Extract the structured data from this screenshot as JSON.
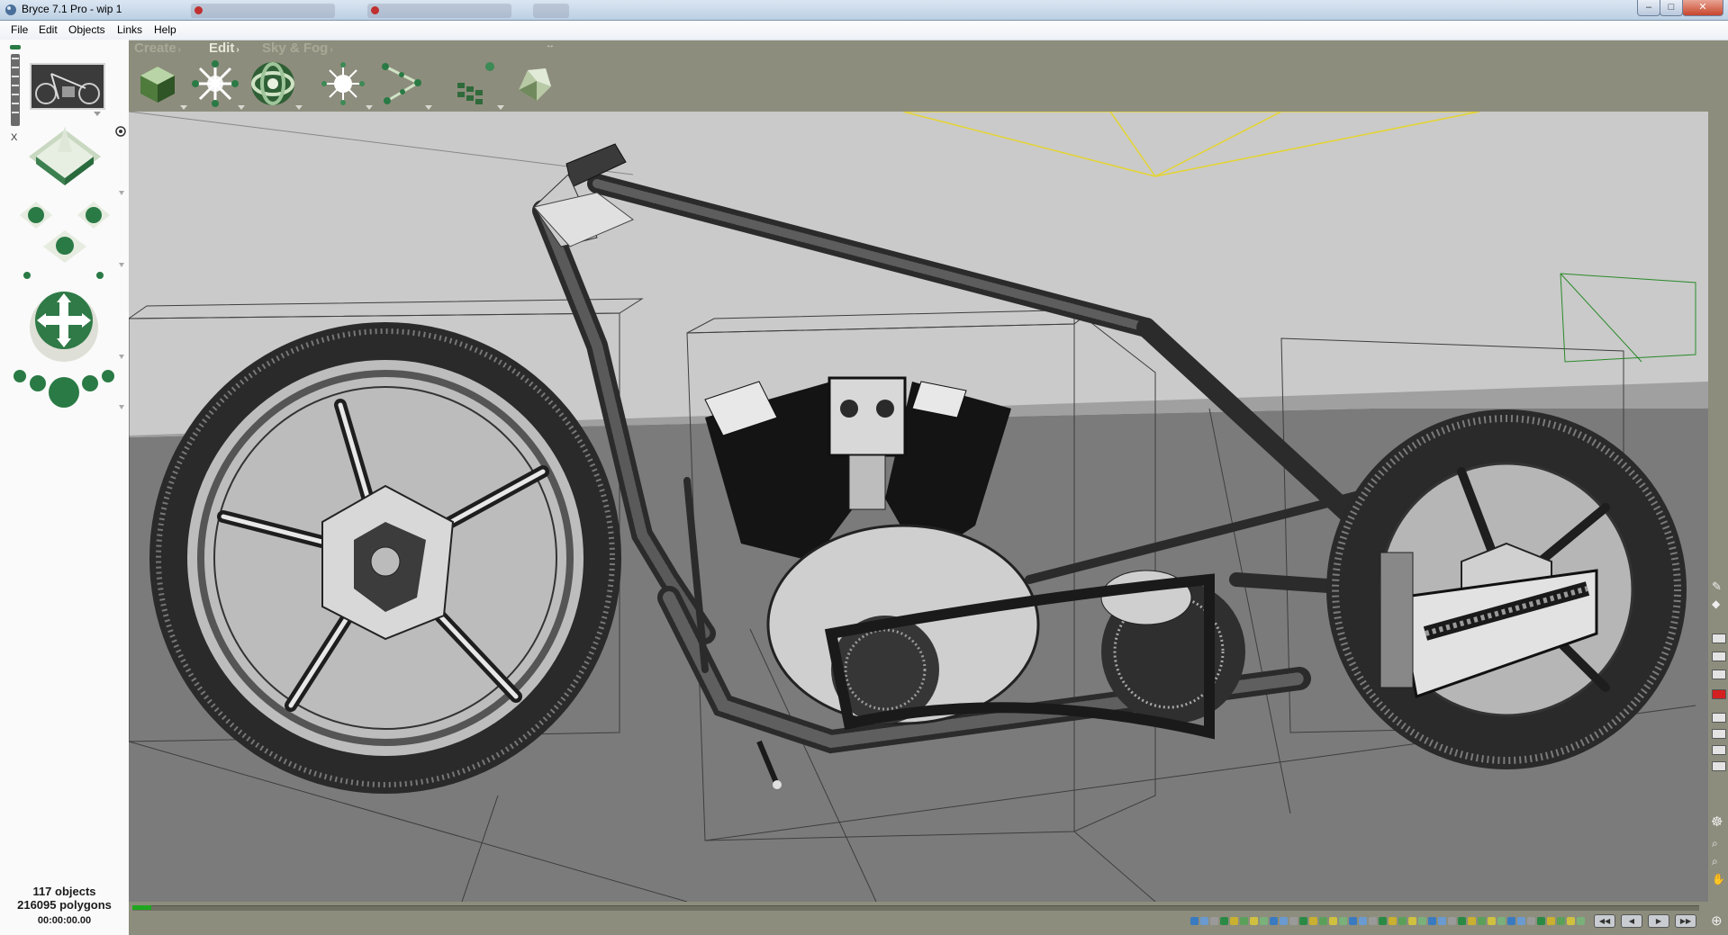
{
  "window": {
    "title": "Bryce 7.1  Pro - wip 1"
  },
  "menu": {
    "items": [
      "File",
      "Edit",
      "Objects",
      "Links",
      "Help"
    ]
  },
  "palette_tabs": [
    {
      "label": "Create",
      "arrow": "›"
    },
    {
      "label": "Edit",
      "arrow": "›"
    },
    {
      "label": "Sky & Fog",
      "arrow": "›"
    }
  ],
  "status": {
    "objects": "117 objects",
    "polygons": "216095 polygons",
    "time": "00:00:00.00"
  },
  "timeline": {
    "progress": 0.012
  },
  "icons": {
    "create_tools": [
      "cube-materials-icon",
      "transform-icon",
      "sphere-torus-icon",
      "light-icon",
      "path-link-icon",
      "terrain-grid-icon",
      "rock-icon"
    ],
    "left_tools": [
      "nano-preview",
      "camera-trackball-icon",
      "view-cross-icon",
      "pan-ball-icon",
      "zoom-dots-icon"
    ]
  },
  "colors": {
    "toolbar_bg": "#8d8d7d",
    "sky": "#c9c9c9",
    "ground": "#7a7a7a",
    "accent_green": "#2a7a45",
    "camera_wire": "#e8d430"
  }
}
